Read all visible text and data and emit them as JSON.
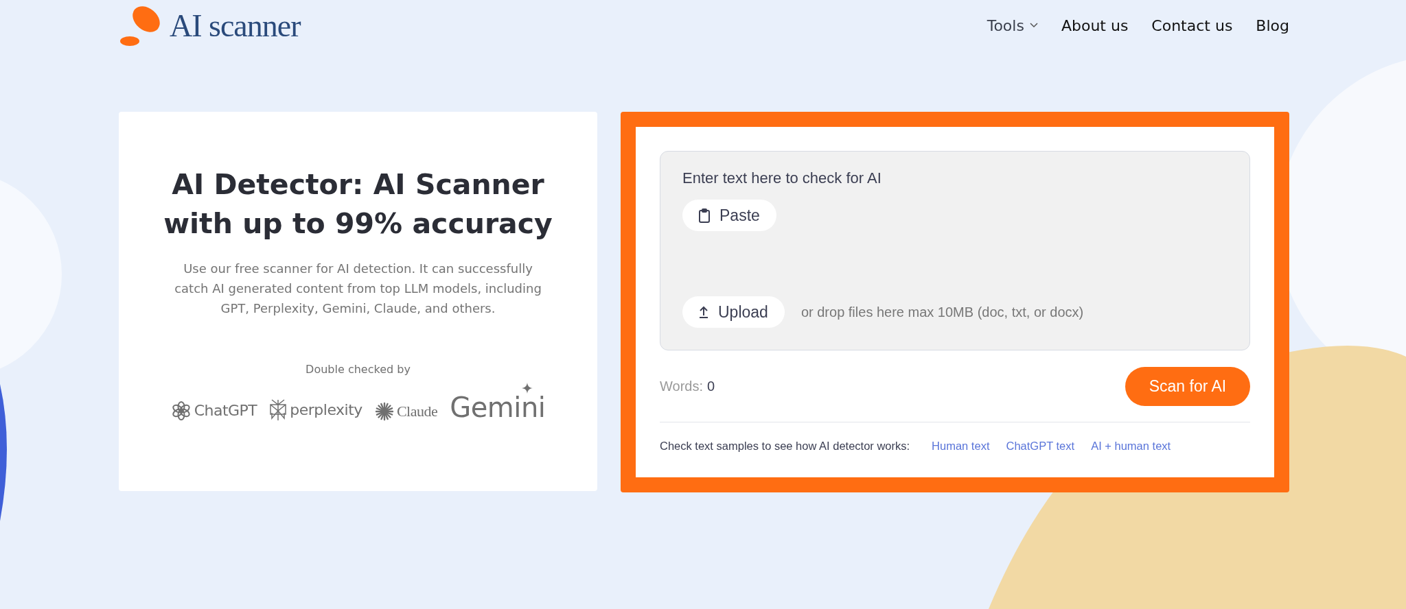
{
  "header": {
    "logo": "AI scanner",
    "nav": [
      {
        "label": "Tools",
        "kind": "dropdown"
      },
      {
        "label": "About us",
        "kind": "link"
      },
      {
        "label": "Contact us",
        "kind": "link"
      },
      {
        "label": "Blog",
        "kind": "link"
      }
    ]
  },
  "intro": {
    "title": "AI Detector: AI Scanner with up to 99% accuracy",
    "description": "Use our free scanner for AI detection. It can successfully catch AI generated content from top LLM models, including GPT, Perplexity, Gemini, Claude, and others.",
    "checked_by": "Double checked by",
    "logos": [
      {
        "name": "ChatGPT",
        "kind": "chatgpt"
      },
      {
        "name": "perplexity",
        "kind": "perplexity"
      },
      {
        "name": "Claude",
        "kind": "claude"
      },
      {
        "name": "Gemini",
        "kind": "gemini"
      }
    ]
  },
  "scanner": {
    "placeholder": "Enter text here to check for AI",
    "paste_button": "Paste",
    "upload_button": "Upload",
    "upload_hint": "or drop files here max 10MB (doc, txt, or docx)",
    "words_label": "Words:",
    "words_count": "0",
    "scan_button": "Scan for AI",
    "samples_label": "Check text samples to see how AI detector works:",
    "samples": [
      "Human text",
      "ChatGPT text",
      "AI + human text"
    ]
  }
}
